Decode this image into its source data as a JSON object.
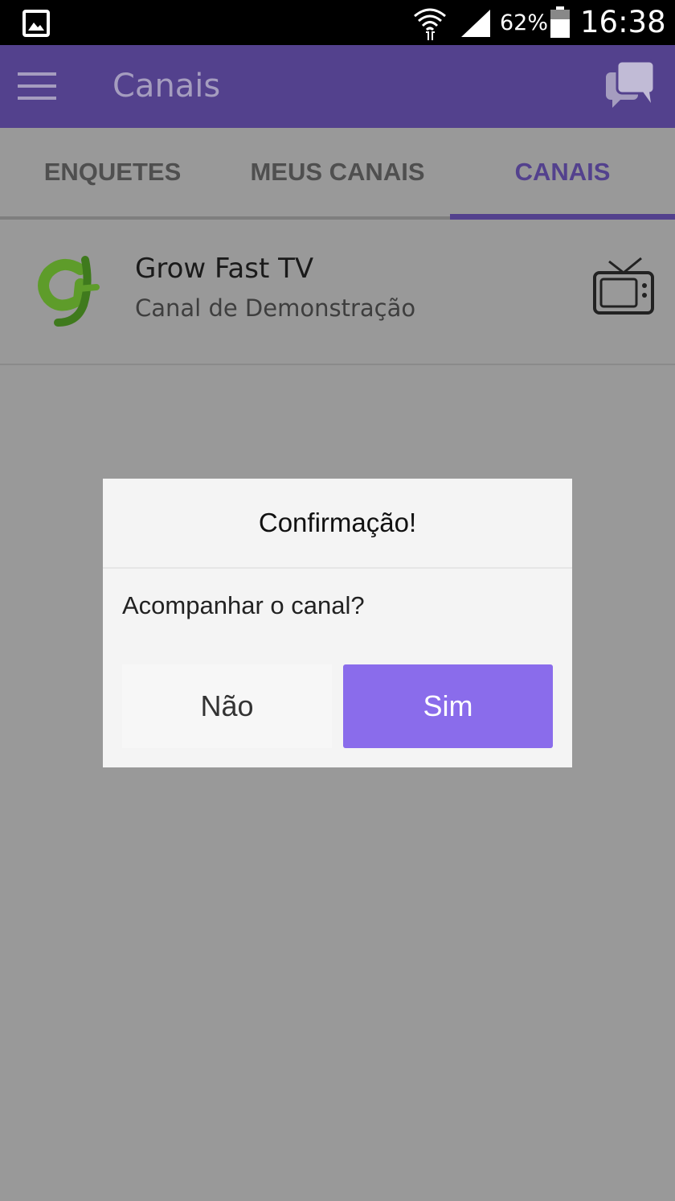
{
  "status_bar": {
    "battery_percent": "62%",
    "time": "16:38",
    "icons": [
      "gallery-icon",
      "wifi-icon",
      "signal-icon",
      "battery-icon"
    ]
  },
  "app_bar": {
    "title": "Canais",
    "icons": [
      "menu-icon",
      "chat-icon"
    ]
  },
  "tabs": [
    {
      "label": "ENQUETES",
      "active": false
    },
    {
      "label": "MEUS CANAIS",
      "active": false
    },
    {
      "label": "CANAIS",
      "active": true
    }
  ],
  "channels": [
    {
      "name": "Grow Fast TV",
      "description": "Canal de Demonstração",
      "icons": [
        "channel-logo",
        "tv-icon"
      ]
    }
  ],
  "dialog": {
    "title": "Confirmação!",
    "message": "Acompanhar o canal?",
    "cancel_label": "Não",
    "confirm_label": "Sim"
  },
  "colors": {
    "primary": "#53418d",
    "accent": "#8a6ceb",
    "logo_green": "#5e9c2a",
    "overlay": "#999999"
  }
}
